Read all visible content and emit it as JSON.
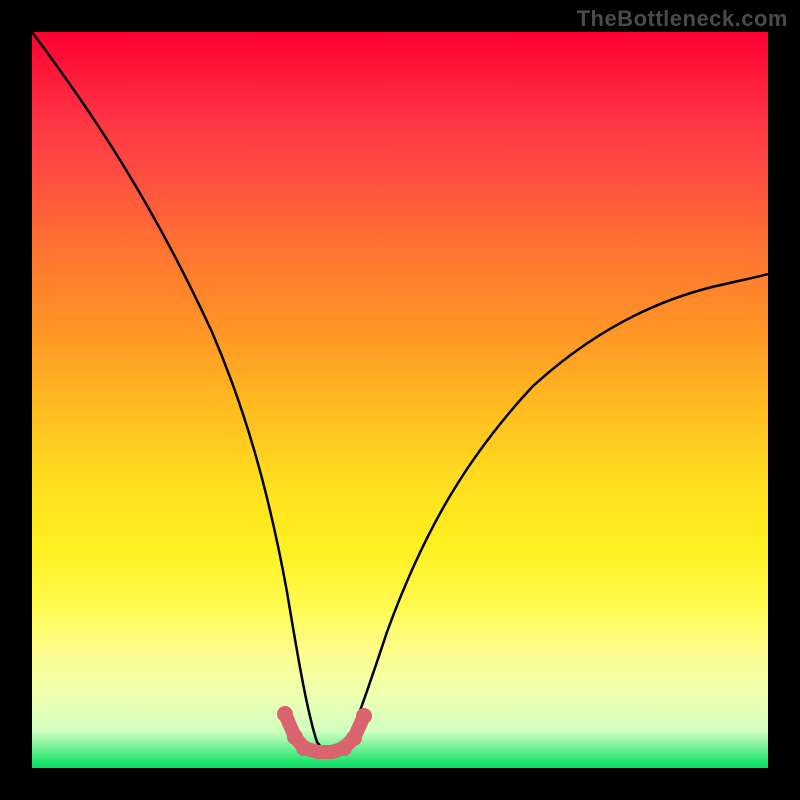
{
  "watermark": "TheBottleneck.com",
  "chart_data": {
    "type": "line",
    "title": "",
    "xlabel": "",
    "ylabel": "",
    "xlim": [
      0,
      100
    ],
    "ylim": [
      0,
      100
    ],
    "series": [
      {
        "name": "curve",
        "x": [
          0,
          5,
          10,
          15,
          20,
          25,
          30,
          33,
          35,
          37,
          39,
          41,
          43,
          45,
          50,
          55,
          60,
          65,
          70,
          75,
          80,
          85,
          90,
          95,
          100
        ],
        "values": [
          100,
          90,
          80,
          69,
          57,
          44,
          29,
          18,
          10,
          4,
          2,
          2,
          4,
          9,
          19,
          27,
          34,
          40,
          45,
          49,
          53,
          56,
          58,
          60,
          61
        ]
      },
      {
        "name": "marker-band",
        "x": [
          33,
          35,
          37,
          39,
          41,
          43,
          45
        ],
        "values": [
          6,
          4,
          3,
          3,
          3,
          4,
          6
        ]
      }
    ],
    "colors": {
      "curve": "#000000",
      "marker": "#d9646e"
    }
  }
}
